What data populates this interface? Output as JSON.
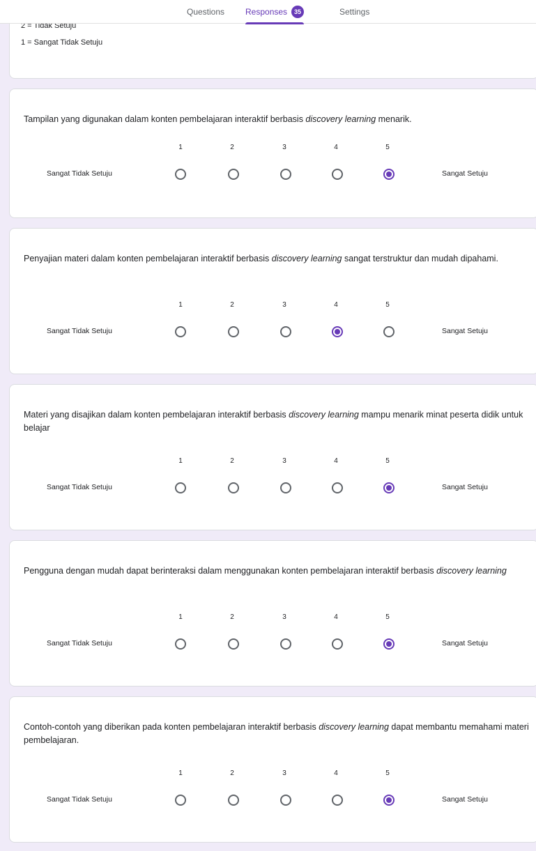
{
  "tabs": {
    "questions": "Questions",
    "responses": "Responses",
    "responses_count": "35",
    "settings": "Settings"
  },
  "intro": {
    "line1": "2 = Tidak Setuju",
    "line2": "1 = Sangat Tidak Setuju"
  },
  "scale": {
    "n1": "1",
    "n2": "2",
    "n3": "3",
    "n4": "4",
    "n5": "5",
    "low_label": "Sangat Tidak Setuju",
    "high_label": "Sangat Setuju"
  },
  "questions": [
    {
      "text_before": "Tampilan yang digunakan dalam konten pembelajaran interaktif berbasis ",
      "text_italic": "discovery learning",
      "text_after": " menarik.",
      "selected": 5
    },
    {
      "text_before": "Penyajian materi dalam konten pembelajaran interaktif berbasis ",
      "text_italic": "discovery learning",
      "text_after": " sangat terstruktur dan mudah dipahami.",
      "selected": 4
    },
    {
      "text_before": "Materi yang disajikan dalam konten pembelajaran interaktif berbasis ",
      "text_italic": "discovery learning",
      "text_after": " mampu menarik minat peserta didik untuk belajar",
      "selected": 5
    },
    {
      "text_before": "Pengguna dengan mudah dapat berinteraksi dalam menggunakan konten pembelajaran interaktif berbasis ",
      "text_italic": "discovery learning",
      "text_after": "",
      "selected": 5
    },
    {
      "text_before": "Contoh-contoh yang diberikan pada konten pembelajaran interaktif berbasis ",
      "text_italic": "discovery learning",
      "text_after": " dapat membantu memahami materi pembelajaran.",
      "selected": 5
    }
  ],
  "colors": {
    "accent": "#673ab7",
    "background": "#f0ebf8"
  }
}
